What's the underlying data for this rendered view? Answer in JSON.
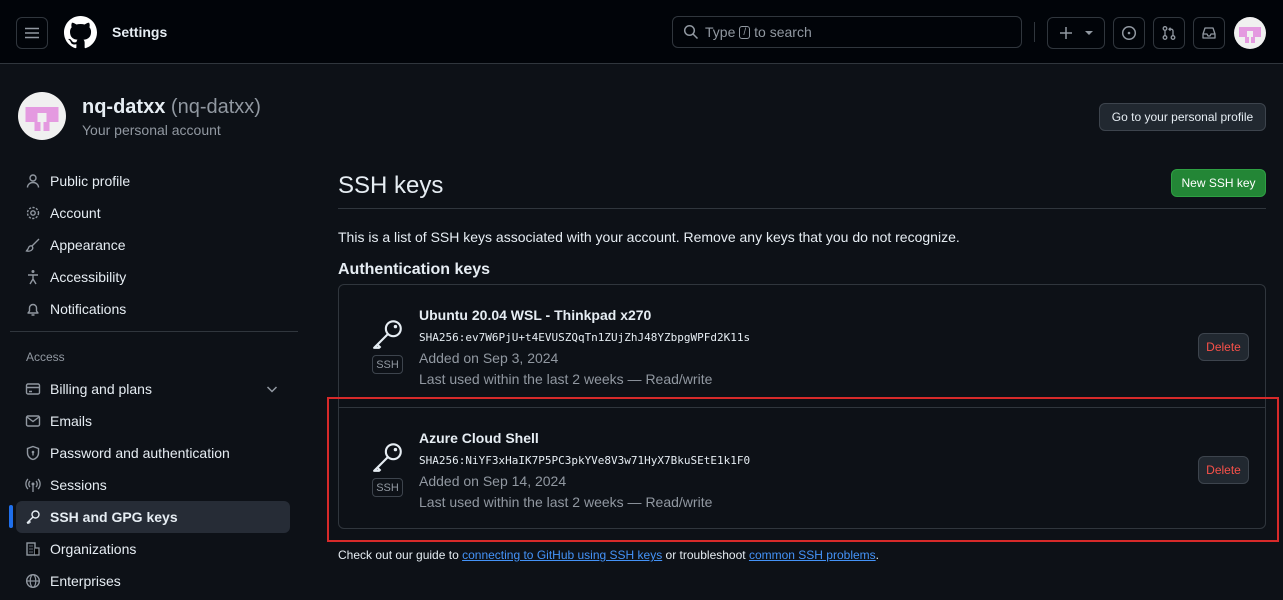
{
  "header": {
    "title": "Settings",
    "search_prefix": "Type",
    "search_key": "/",
    "search_suffix": "to search"
  },
  "user": {
    "name": "nq-datxx",
    "handle": "(nq-datxx)",
    "subtitle": "Your personal account",
    "profile_button": "Go to your personal profile"
  },
  "sidebar": {
    "items": [
      {
        "label": "Public profile",
        "icon": "person-icon"
      },
      {
        "label": "Account",
        "icon": "gear-icon"
      },
      {
        "label": "Appearance",
        "icon": "paintbrush-icon"
      },
      {
        "label": "Accessibility",
        "icon": "accessibility-icon"
      },
      {
        "label": "Notifications",
        "icon": "bell-icon"
      }
    ],
    "group_label": "Access",
    "access_items": [
      {
        "label": "Billing and plans",
        "icon": "credit-card-icon"
      },
      {
        "label": "Emails",
        "icon": "mail-icon"
      },
      {
        "label": "Password and authentication",
        "icon": "shield-lock-icon"
      },
      {
        "label": "Sessions",
        "icon": "broadcast-icon"
      },
      {
        "label": "SSH and GPG keys",
        "icon": "key-icon"
      },
      {
        "label": "Organizations",
        "icon": "organization-icon"
      },
      {
        "label": "Enterprises",
        "icon": "globe-icon"
      }
    ]
  },
  "main": {
    "title": "SSH keys",
    "new_button": "New SSH key",
    "description": "This is a list of SSH keys associated with your account. Remove any keys that you do not recognize.",
    "section_title": "Authentication keys",
    "keys": [
      {
        "title": "Ubuntu 20.04 WSL - Thinkpad x270",
        "fingerprint": "SHA256:ev7W6PjU+t4EVUSZQqTn1ZUjZhJ48YZbpgWPFd2K11s",
        "added": "Added on Sep 3, 2024",
        "used": "Last used within the last 2 weeks — Read/write",
        "badge": "SSH",
        "delete_label": "Delete"
      },
      {
        "title": "Azure Cloud Shell",
        "fingerprint": "SHA256:NiYF3xHaIK7P5PC3pkYVe8V3w71HyX7BkuSEtE1k1F0",
        "added": "Added on Sep 14, 2024",
        "used": "Last used within the last 2 weeks — Read/write",
        "badge": "SSH",
        "delete_label": "Delete"
      }
    ],
    "footer": {
      "prefix": "Check out our guide to",
      "link1": "connecting to GitHub using SSH keys",
      "middle": "or troubleshoot",
      "link2": "common SSH problems",
      "suffix": "."
    }
  },
  "colors": {
    "background": "#0d1117",
    "header_bg": "#010409",
    "accent_blue": "#1f6feb",
    "primary_green": "#238636",
    "danger_red": "#f85149",
    "highlight_red": "#d72a2a"
  }
}
